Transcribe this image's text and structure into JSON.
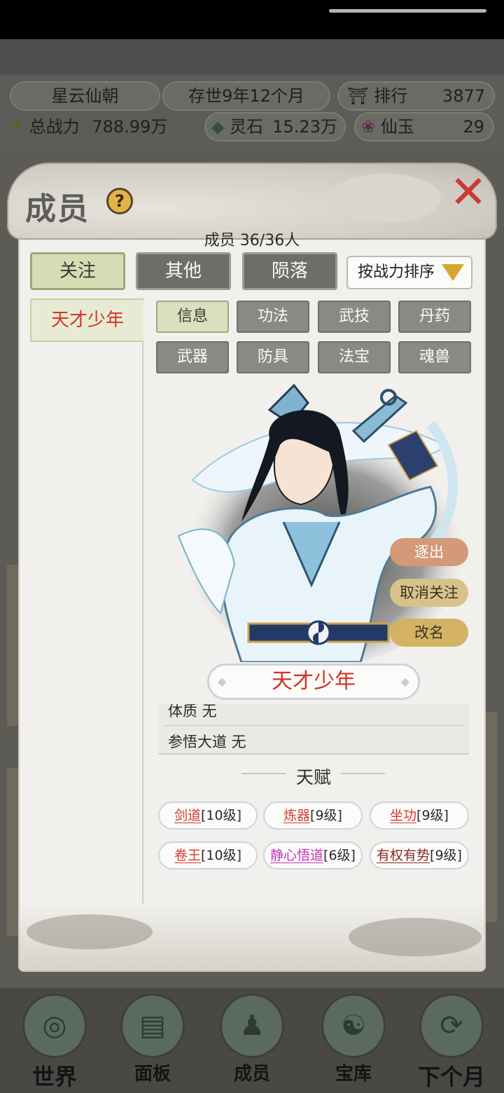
{
  "header": {
    "sect_name": "星云仙朝",
    "time": "存世9年12个月",
    "rank_label": "排行",
    "rank_value": "3877",
    "power_label": "总战力",
    "power_value": "788.99万",
    "spirit_stone_label": "灵石",
    "spirit_stone_value": "15.23万",
    "jade_label": "仙玉",
    "jade_value": "29"
  },
  "bottom_nav": [
    {
      "label": "世界",
      "icon": "world-icon"
    },
    {
      "label": "面板",
      "icon": "scroll-icon"
    },
    {
      "label": "成员",
      "icon": "member-icon"
    },
    {
      "label": "宝库",
      "icon": "treasury-icon"
    },
    {
      "label": "下个月",
      "icon": "next-month-icon"
    }
  ],
  "dialog": {
    "title": "成员",
    "help": "?",
    "close": "✕",
    "member_count": "成员  36/36人",
    "categories": [
      "关注",
      "其他",
      "陨落"
    ],
    "active_category": "关注",
    "sort_label": "按战力排序",
    "members": [
      "天才少年"
    ],
    "info_tabs": [
      "信息",
      "功法",
      "武技",
      "丹药",
      "武器",
      "防具",
      "法宝",
      "魂兽"
    ],
    "active_info_tab": "信息",
    "actions": {
      "expel": "逐出",
      "unfollow": "取消关注",
      "rename": "改名"
    },
    "character_name": "天才少年",
    "attributes": [
      "体质 无",
      "参悟大道 无"
    ],
    "talent_title": "天赋",
    "talents": [
      {
        "name": "剑道",
        "level": "[10级]",
        "color": "#d73a2f"
      },
      {
        "name": "炼器",
        "level": "[9级]",
        "color": "#d73a2f"
      },
      {
        "name": "坐功",
        "level": "[9级]",
        "color": "#d73a2f"
      },
      {
        "name": "卷王",
        "level": "[10级]",
        "color": "#d73a2f"
      },
      {
        "name": "静心悟道",
        "level": "[6级]",
        "color": "#c236b8"
      },
      {
        "name": "有权有势",
        "level": "[9级]",
        "color": "#8b2a20"
      }
    ]
  }
}
